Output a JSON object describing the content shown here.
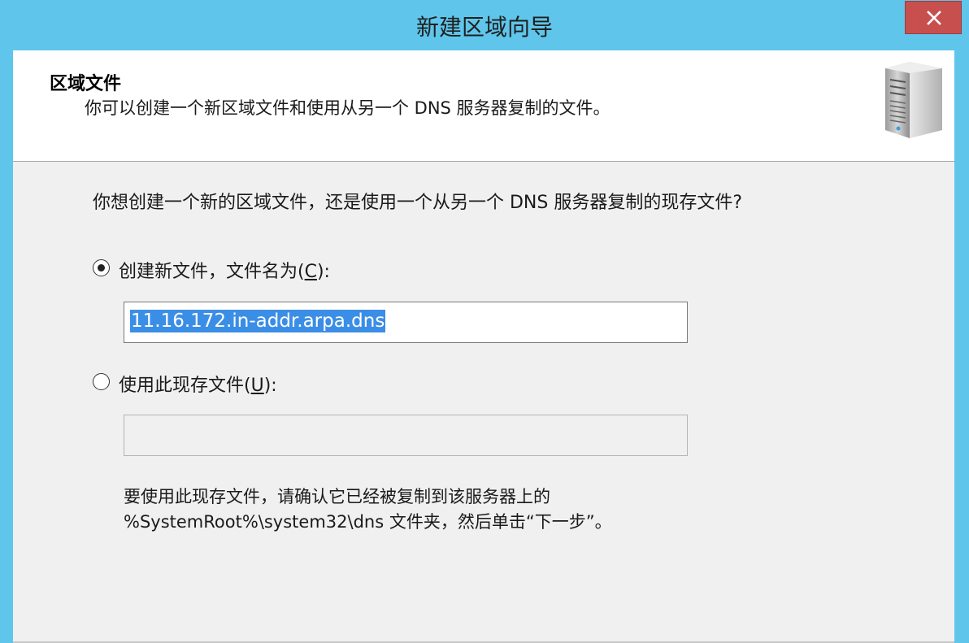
{
  "window": {
    "title": "新建区域向导",
    "close_icon": "close-icon"
  },
  "header": {
    "title": "区域文件",
    "subtitle": "你可以创建一个新区域文件和使用从另一个 DNS 服务器复制的文件。",
    "icon": "server-icon"
  },
  "main": {
    "question": "你想创建一个新的区域文件，还是使用一个从另一个 DNS 服务器复制的现存文件?",
    "option_create": {
      "label_before": "创建新文件，文件名为(",
      "mnemonic": "C",
      "label_after": "):",
      "selected": true,
      "value": "11.16.172.in-addr.arpa.dns"
    },
    "option_existing": {
      "label_before": "使用此现存文件(",
      "mnemonic": "U",
      "label_after": "):",
      "selected": false,
      "value": ""
    },
    "note_line1": "要使用此现存文件，请确认它已经被复制到该服务器上的",
    "note_line2": "%SystemRoot%\\system32\\dns 文件夹，然后单击“下一步”。"
  },
  "colors": {
    "titlebar": "#5fc5eb",
    "close_button": "#c7504f",
    "selection": "#3b8ee6"
  }
}
